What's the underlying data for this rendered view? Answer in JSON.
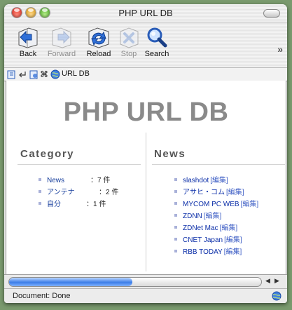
{
  "window": {
    "title": "PHP URL DB"
  },
  "toolbar": {
    "items": [
      {
        "label": "Back",
        "icon": "back-arrow-icon",
        "enabled": true
      },
      {
        "label": "Forward",
        "icon": "forward-arrow-icon",
        "enabled": false
      },
      {
        "label": "Reload",
        "icon": "reload-icon",
        "enabled": true
      },
      {
        "label": "Stop",
        "icon": "stop-icon",
        "enabled": false
      },
      {
        "label": "Search",
        "icon": "search-magnifier-icon",
        "enabled": true
      }
    ],
    "more_icon": "toolbar-overflow-chevron-icon"
  },
  "bookmarks_bar": {
    "page_title": "URL DB"
  },
  "page": {
    "heading": "PHP URL DB",
    "category": {
      "title": "Category",
      "items": [
        {
          "name": "News",
          "count": "：7 件"
        },
        {
          "name": "アンテナ",
          "count": "：2 件"
        },
        {
          "name": "自分",
          "count": "：1 件"
        }
      ]
    },
    "news": {
      "title": "News",
      "edit_label": "[編集]",
      "items": [
        {
          "name": "slashdot"
        },
        {
          "name": "アサヒ・コム"
        },
        {
          "name": "MYCOM PC WEB"
        },
        {
          "name": "ZDNN"
        },
        {
          "name": "ZDNet Mac"
        },
        {
          "name": "CNET Japan"
        },
        {
          "name": "RBB TODAY"
        }
      ]
    }
  },
  "status": {
    "text": "Document: Done",
    "progress": 0.49
  },
  "colors": {
    "heading": "#8a8a8a",
    "link": "#0b2ea8",
    "progress": "#3d7ee8"
  }
}
